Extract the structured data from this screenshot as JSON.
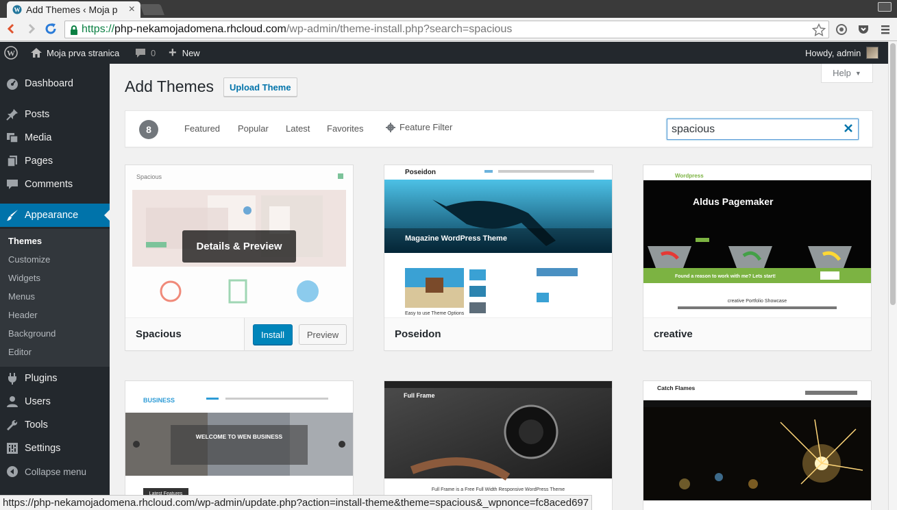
{
  "browser": {
    "tab_title": "Add Themes ‹ Moja p",
    "url_scheme": "https://",
    "url_host": "php-nekamojadomena.rhcloud.com",
    "url_path": "/wp-admin/theme-install.php?search=spacious",
    "status_url": "https://php-nekamojadomena.rhcloud.com/wp-admin/update.php?action=install-theme&theme=spacious&_wpnonce=fc8aced697"
  },
  "adminbar": {
    "site_name": "Moja prva stranica",
    "comments_count": "0",
    "new_label": "New",
    "howdy": "Howdy, admin"
  },
  "sidebar": {
    "items": [
      {
        "label": "Dashboard",
        "icon": "dashboard-icon"
      },
      {
        "label": "Posts",
        "icon": "pin-icon"
      },
      {
        "label": "Media",
        "icon": "media-icon"
      },
      {
        "label": "Pages",
        "icon": "pages-icon"
      },
      {
        "label": "Comments",
        "icon": "comment-icon"
      },
      {
        "label": "Appearance",
        "icon": "brush-icon"
      },
      {
        "label": "Plugins",
        "icon": "plug-icon"
      },
      {
        "label": "Users",
        "icon": "user-icon"
      },
      {
        "label": "Tools",
        "icon": "wrench-icon"
      },
      {
        "label": "Settings",
        "icon": "settings-icon"
      },
      {
        "label": "Collapse menu",
        "icon": "collapse-icon"
      }
    ],
    "appearance_submenu": [
      "Themes",
      "Customize",
      "Widgets",
      "Menus",
      "Header",
      "Background",
      "Editor"
    ]
  },
  "main": {
    "title": "Add Themes",
    "upload_button": "Upload Theme",
    "help_button": "Help",
    "filter": {
      "count": "8",
      "links": [
        "Featured",
        "Popular",
        "Latest",
        "Favorites"
      ],
      "feature_filter": "Feature Filter",
      "search_value": "spacious"
    },
    "themes": [
      {
        "name": "Spacious",
        "overlay": "Details & Preview",
        "install": "Install",
        "preview": "Preview"
      },
      {
        "name": "Poseidon"
      },
      {
        "name": "creative"
      }
    ],
    "screenshots": {
      "spacious": {
        "title": "Spacious"
      },
      "poseidon": {
        "brand": "Poseidon",
        "hero_title": "Magazine WordPress Theme",
        "caption": "Easy to use Theme Options"
      },
      "creative": {
        "brand": "Wordpress",
        "hero_title": "Aldus Pagemaker",
        "banner": "Found a reason to work with me? Lets start!",
        "section": "creative Portfolio Showcase"
      },
      "wen_business": {
        "brand": "BUSINESS",
        "hero_title": "WELCOME TO WEN BUSINESS",
        "tag": "Latest Features"
      },
      "full_frame": {
        "brand": "Full Frame",
        "caption": "Full Frame is a Free Full Width Responsive WordPress Theme"
      },
      "catch_flames": {
        "brand": "Catch Flames"
      }
    }
  },
  "colors": {
    "admin_dark": "#23282d",
    "accent": "#0073aa",
    "install_blue": "#0085ba",
    "green_banner": "#7cb342"
  }
}
